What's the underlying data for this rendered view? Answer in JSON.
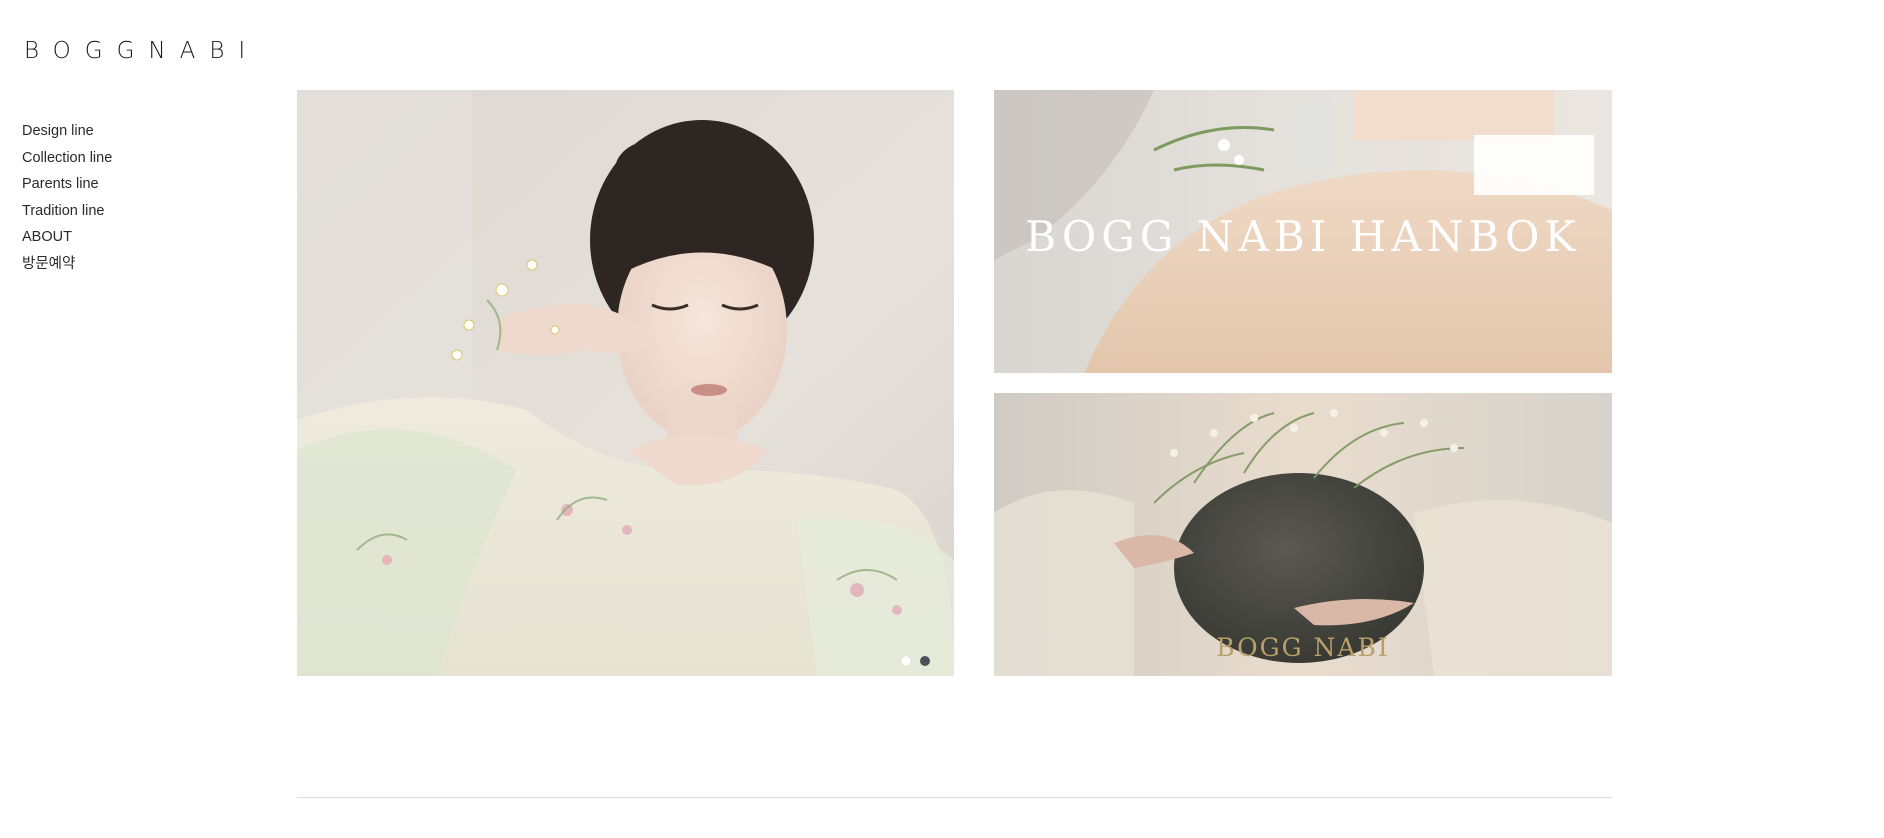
{
  "brand": {
    "logo_text": "BOGGNABI"
  },
  "nav": {
    "items": [
      {
        "label": "Design line"
      },
      {
        "label": "Collection line"
      },
      {
        "label": "Parents line"
      },
      {
        "label": "Tradition line"
      },
      {
        "label": "ABOUT"
      },
      {
        "label": "방문예약"
      }
    ]
  },
  "slider": {
    "slide_count": 2,
    "active_index": 0
  },
  "promo": {
    "top_title": "BOGG NABI HANBOK",
    "bottom_brand": "BOGG NABI"
  },
  "colors": {
    "background": "#ffffff",
    "text": "#222222",
    "dot_active": "#ffffff",
    "dot_inactive": "#4e5058",
    "brand_gold": "#b8a06a",
    "divider": "#dcdcdc"
  }
}
